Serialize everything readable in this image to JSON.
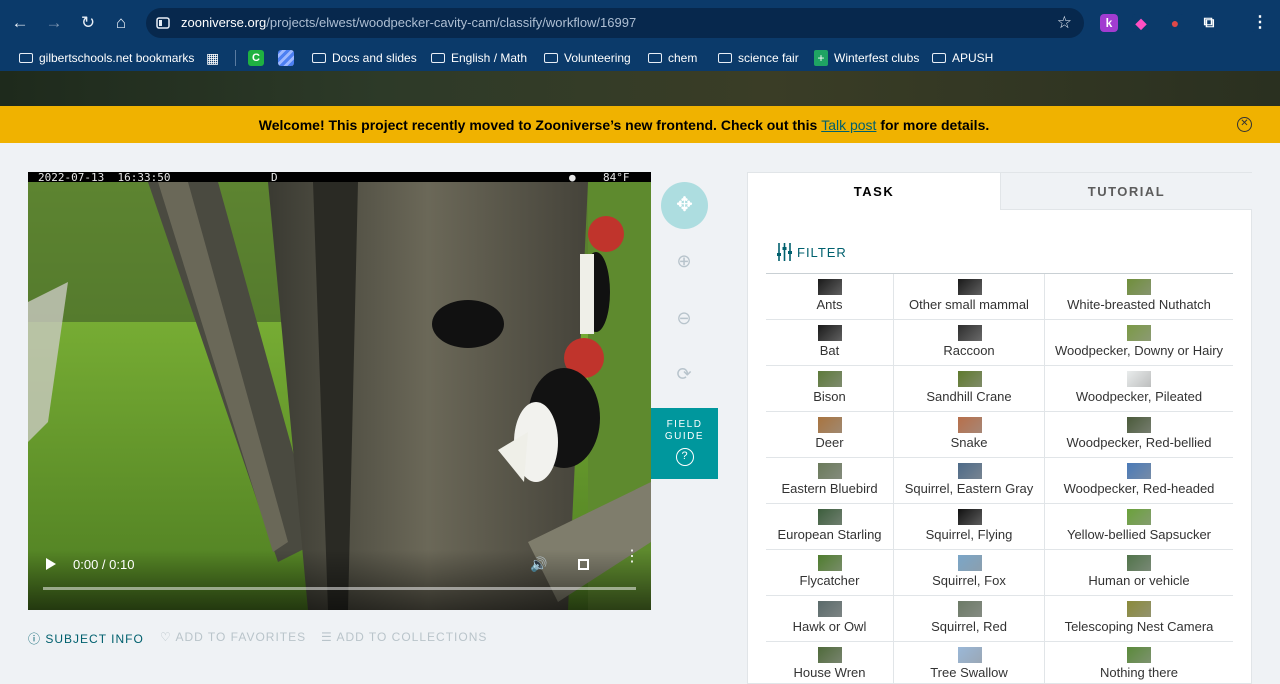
{
  "browser": {
    "url_host": "zooniverse.org",
    "url_path": "/projects/elwest/woodpecker-cavity-cam/classify/workflow/16997",
    "bookmarks": [
      "gilbertschools.net bookmarks",
      "Docs and slides",
      "English / Math",
      "Volunteering",
      "chem",
      "science fair",
      "Winterfest clubs",
      "APUSH"
    ]
  },
  "announcement": {
    "text_before": "Welcome! This project recently moved to Zooniverse’s new frontend. Check out this",
    "link": "Talk post",
    "text_after": "for more details."
  },
  "video": {
    "date_stamp": "2022-07-13  16:33:50",
    "channel": "D",
    "temp": "84°F",
    "time": "0:00 / 0:10",
    "progress": 0
  },
  "tools": {
    "field_guide": "FIELD\nGUIDE"
  },
  "subject_links": {
    "info": "SUBJECT INFO",
    "favorites": "ADD TO FAVORITES",
    "collections": "ADD TO COLLECTIONS"
  },
  "panel": {
    "tab_task": "TASK",
    "tab_tutorial": "TUTORIAL",
    "filter": "FILTER",
    "choices": [
      [
        "Ants",
        "Other small mammal",
        "White-breasted Nuthatch"
      ],
      [
        "Bat",
        "Raccoon",
        "Woodpecker, Downy or Hairy"
      ],
      [
        "Bison",
        "Sandhill Crane",
        "Woodpecker, Pileated"
      ],
      [
        "Deer",
        "Snake",
        "Woodpecker, Red-bellied"
      ],
      [
        "Eastern Bluebird",
        "Squirrel, Eastern Gray",
        "Woodpecker, Red-headed"
      ],
      [
        "European Starling",
        "Squirrel, Flying",
        "Yellow-bellied Sapsucker"
      ],
      [
        "Flycatcher",
        "Squirrel, Fox",
        "Human or vehicle"
      ],
      [
        "Hawk or Owl",
        "Squirrel, Red",
        "Telescoping Nest Camera"
      ],
      [
        "House Wren",
        "Tree Swallow",
        "Nothing there"
      ]
    ]
  },
  "colors": {
    "chrome": "#0b3a6a",
    "banner": "#f0b200",
    "teal": "#00979d",
    "link_teal": "#00606e"
  }
}
